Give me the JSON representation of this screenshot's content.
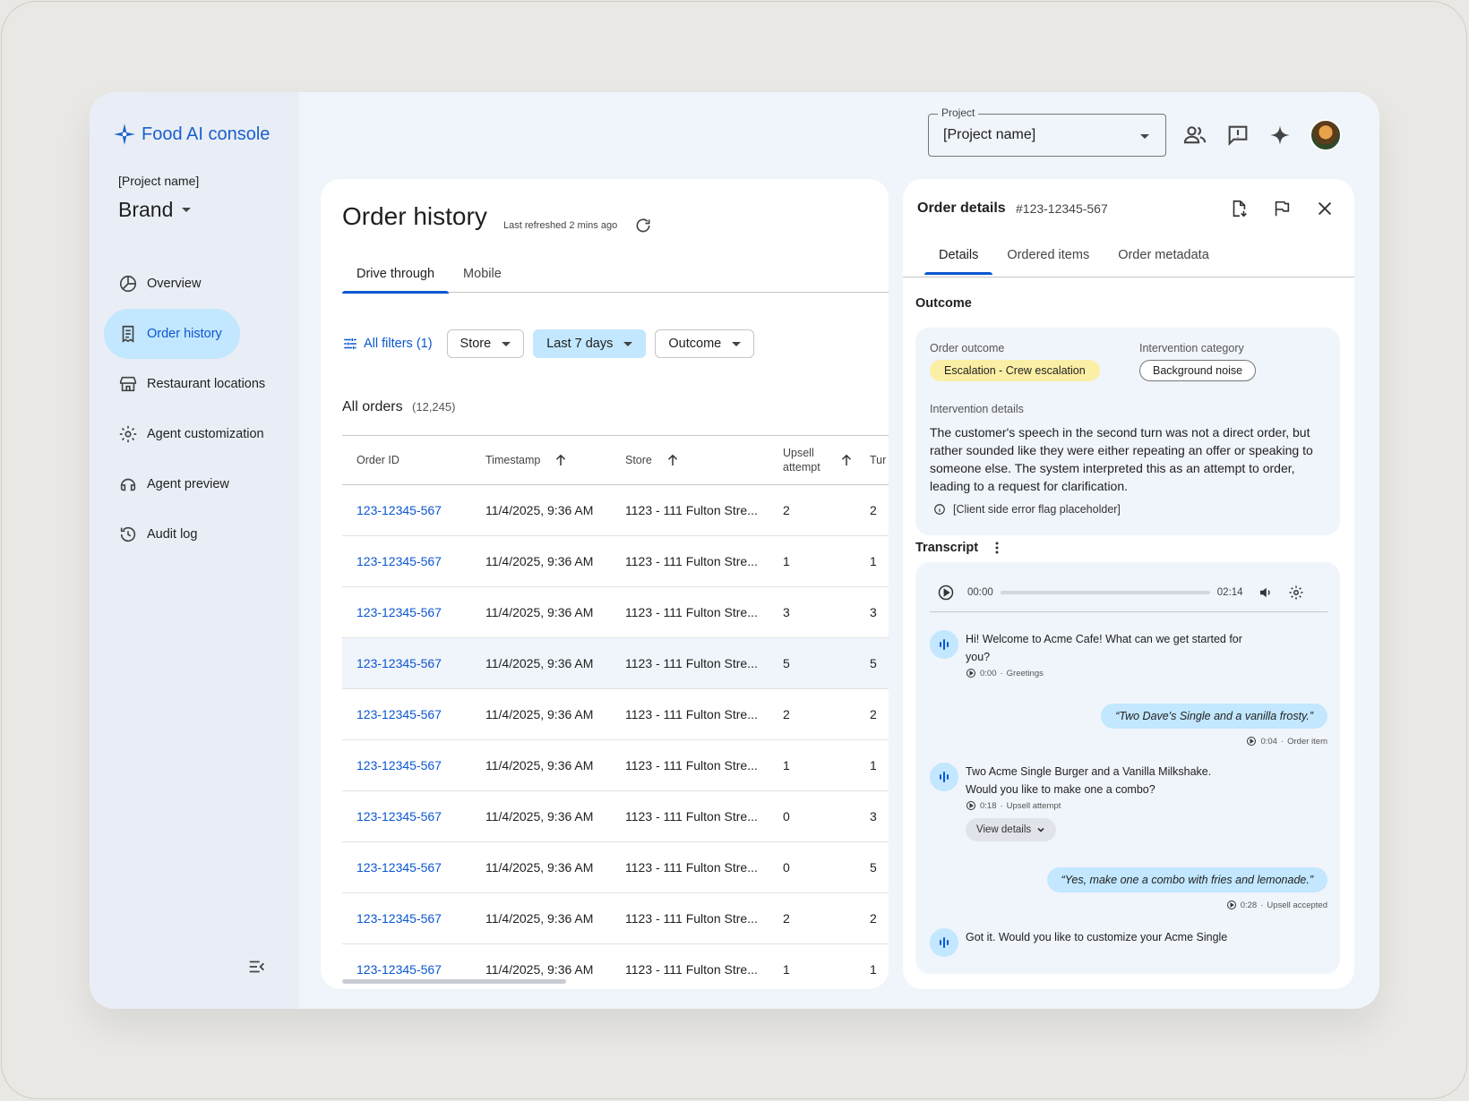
{
  "app": {
    "title": "Food AI console"
  },
  "sidebar": {
    "project_name": "[Project name]",
    "brand": "Brand",
    "items": [
      {
        "label": "Overview",
        "icon": "pie-chart-icon"
      },
      {
        "label": "Order history",
        "icon": "receipt-icon",
        "active": true
      },
      {
        "label": "Restaurant locations",
        "icon": "storefront-icon"
      },
      {
        "label": "Agent customization",
        "icon": "gear-icon"
      },
      {
        "label": "Agent preview",
        "icon": "agent-preview-icon"
      },
      {
        "label": "Audit log",
        "icon": "history-icon"
      }
    ]
  },
  "topbar": {
    "project_label": "Project",
    "project_value": "[Project name]"
  },
  "orders": {
    "title": "Order history",
    "refreshed": "Last refreshed 2 mins ago",
    "tabs": [
      "Drive through",
      "Mobile"
    ],
    "filters": {
      "all": "All filters (1)",
      "store": "Store",
      "date": "Last 7 days",
      "outcome": "Outcome"
    },
    "list_title": "All orders",
    "count": "(12,245)",
    "columns": [
      "Order ID",
      "Timestamp",
      "Store",
      "Upsell attempt",
      "Tur"
    ],
    "rows": [
      {
        "id": "123-12345-567",
        "ts": "11/4/2025, 9:36 AM",
        "store": "1123 - 111 Fulton Stre...",
        "upsell": "2",
        "turns": "2"
      },
      {
        "id": "123-12345-567",
        "ts": "11/4/2025, 9:36 AM",
        "store": "1123 - 111 Fulton Stre...",
        "upsell": "1",
        "turns": "1"
      },
      {
        "id": "123-12345-567",
        "ts": "11/4/2025, 9:36 AM",
        "store": "1123 - 111 Fulton Stre...",
        "upsell": "3",
        "turns": "3"
      },
      {
        "id": "123-12345-567",
        "ts": "11/4/2025, 9:36 AM",
        "store": "1123 - 111 Fulton Stre...",
        "upsell": "5",
        "turns": "5"
      },
      {
        "id": "123-12345-567",
        "ts": "11/4/2025, 9:36 AM",
        "store": "1123 - 111 Fulton Stre...",
        "upsell": "2",
        "turns": "2"
      },
      {
        "id": "123-12345-567",
        "ts": "11/4/2025, 9:36 AM",
        "store": "1123 - 111 Fulton Stre...",
        "upsell": "1",
        "turns": "1"
      },
      {
        "id": "123-12345-567",
        "ts": "11/4/2025, 9:36 AM",
        "store": "1123 - 111 Fulton Stre...",
        "upsell": "0",
        "turns": "3"
      },
      {
        "id": "123-12345-567",
        "ts": "11/4/2025, 9:36 AM",
        "store": "1123 - 111 Fulton Stre...",
        "upsell": "0",
        "turns": "5"
      },
      {
        "id": "123-12345-567",
        "ts": "11/4/2025, 9:36 AM",
        "store": "1123 - 111 Fulton Stre...",
        "upsell": "2",
        "turns": "2"
      },
      {
        "id": "123-12345-567",
        "ts": "11/4/2025, 9:36 AM",
        "store": "1123 - 111 Fulton Stre...",
        "upsell": "1",
        "turns": "1"
      }
    ]
  },
  "details": {
    "title": "Order details",
    "order_id": "#123-12345-567",
    "tabs": [
      "Details",
      "Ordered items",
      "Order metadata"
    ],
    "outcome_heading": "Outcome",
    "order_outcome_label": "Order outcome",
    "order_outcome_value": "Escalation - Crew escalation",
    "intervention_category_label": "Intervention category",
    "intervention_category_value": "Background noise",
    "intervention_details_label": "Intervention details",
    "intervention_details": "The customer's speech in the second turn was not a direct order, but rather sounded like they were either repeating an offer or speaking to someone else. The system interpreted this as an attempt to order, leading to a request for clarification.",
    "error_flag": "[Client side error flag placeholder]",
    "transcript_heading": "Transcript",
    "player": {
      "current": "00:00",
      "total": "02:14"
    },
    "messages": [
      {
        "role": "agent",
        "text": "Hi! Welcome to Acme Cafe! What can we get started for you?",
        "time": "0:00",
        "tag": "Greetings"
      },
      {
        "role": "user",
        "text": "“Two Dave's Single and a vanilla frosty.”",
        "time": "0:04",
        "tag": "Order item"
      },
      {
        "role": "agent",
        "text": "Two Acme Single Burger and a Vanilla Milkshake. Would you like to make one a combo?",
        "time": "0:18",
        "tag": "Upsell attempt",
        "action": "View details"
      },
      {
        "role": "user",
        "text": "“Yes, make one a combo with fries and lemonade.”",
        "time": "0:28",
        "tag": "Upsell accepted"
      },
      {
        "role": "agent",
        "text": "Got it.  Would you like to customize your Acme Single"
      }
    ]
  },
  "colors": {
    "accent": "#0b57d0",
    "active_bg": "#c2e7ff",
    "badge_yellow": "#fbefa6"
  }
}
